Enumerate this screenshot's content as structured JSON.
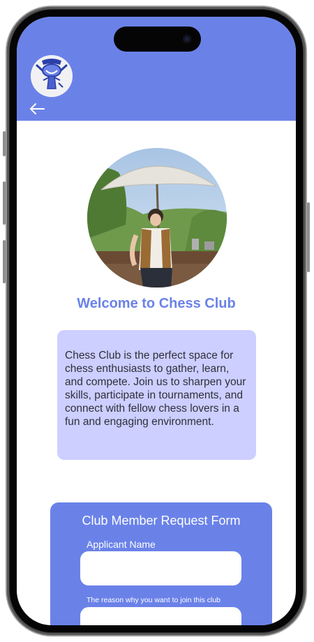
{
  "app": {
    "header_color": "#6a82e8",
    "logo": "chess-club-logo",
    "back_icon": "arrow-left-icon"
  },
  "main": {
    "title": "Welcome to Chess Club",
    "description": "Chess Club is the perfect space for chess enthusiasts to gather, learn, and compete. Join us to sharpen your skills, participate in tournaments, and connect with fellow chess lovers in a fun and engaging environment."
  },
  "form": {
    "title": "Club Member Request Form",
    "applicant_label": "Applicant Name",
    "applicant_value": "",
    "reason_label": "The reason why you want to join this club",
    "reason_value": ""
  },
  "colors": {
    "accent": "#6a82e8",
    "card": "#cccfff"
  }
}
